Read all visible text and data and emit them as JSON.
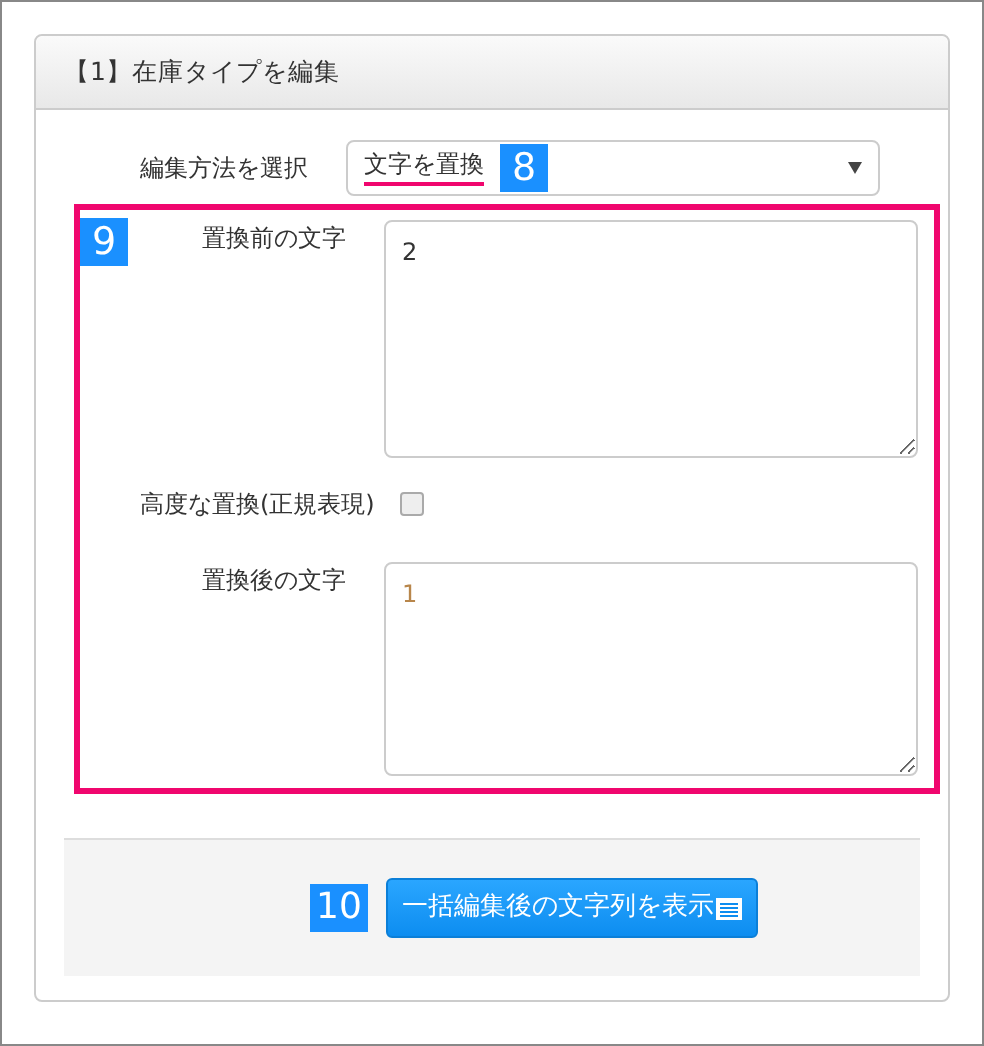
{
  "panel_title": "【1】在庫タイプを編集",
  "method_select": {
    "label": "編集方法を選択",
    "value": "文字を置換",
    "callout": "8"
  },
  "highlight_group": {
    "callout": "9",
    "fields": [
      {
        "kind": "textarea",
        "label": "置換前の文字",
        "value": "2"
      },
      {
        "kind": "checkbox",
        "label": "高度な置換(正規表現)",
        "checked": false
      },
      {
        "kind": "textarea",
        "label": "置換後の文字",
        "value": "1"
      }
    ]
  },
  "footer": {
    "callout": "10",
    "button": "一括編集後の文字列を表示"
  }
}
